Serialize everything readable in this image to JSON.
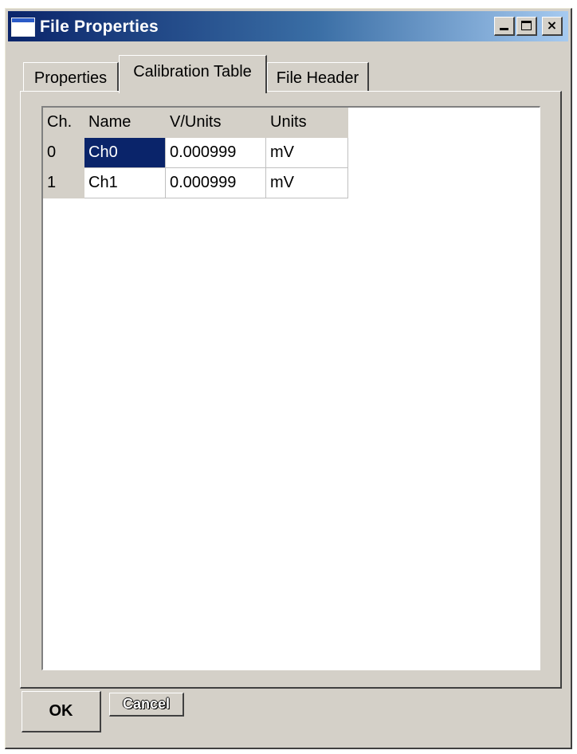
{
  "window": {
    "title": "File Properties",
    "controls": {
      "minimize": "_",
      "maximize": "□",
      "close": "×"
    }
  },
  "tabs": [
    {
      "label": "Properties",
      "active": false
    },
    {
      "label": "Calibration Table",
      "active": true
    },
    {
      "label": "File Header",
      "active": false
    }
  ],
  "calibration_table": {
    "headers": [
      "Ch.",
      "Name",
      "V/Units",
      "Units"
    ],
    "rows": [
      {
        "ch": "0",
        "name": "Ch0",
        "v_units": "0.000999",
        "units": "mV",
        "name_selected": true
      },
      {
        "ch": "1",
        "name": "Ch1",
        "v_units": "0.000999",
        "units": "mV",
        "name_selected": false
      }
    ]
  },
  "buttons": {
    "ok": "OK",
    "cancel": "Cancel"
  },
  "colors": {
    "title_start": "#0a246a",
    "title_end": "#a6caf0",
    "face": "#d4d0c8",
    "selection": "#0a246a"
  }
}
